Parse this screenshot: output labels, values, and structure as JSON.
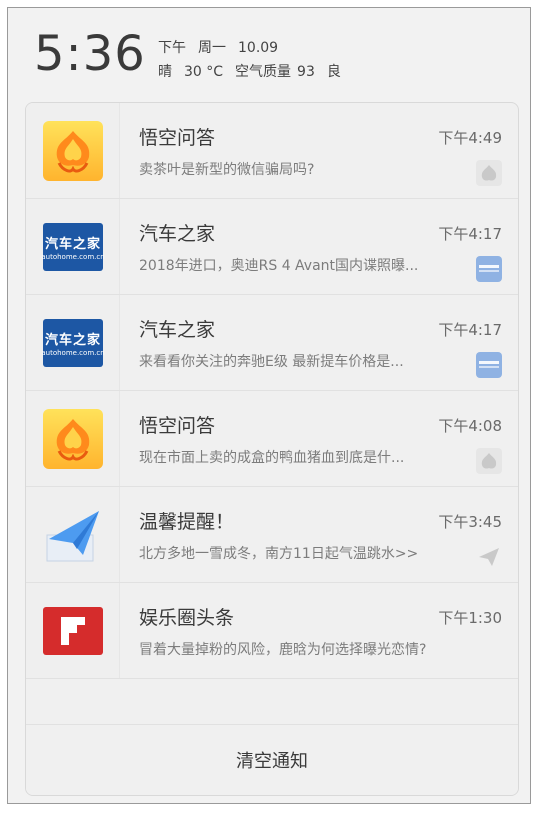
{
  "status": {
    "clock": "5:36",
    "period": "下午",
    "weekday": "周一",
    "date": "10.09",
    "weather": "晴",
    "temperature": "30 °C",
    "air_quality_label": "空气质量",
    "air_quality_value": "93",
    "air_quality_level": "良"
  },
  "notifications": [
    {
      "app": "悟空问答",
      "time": "下午4:49",
      "text": "卖茶叶是新型的微信骗局吗?",
      "icon": "wukong-icon"
    },
    {
      "app": "汽车之家",
      "time": "下午4:17",
      "text": "2018年进口，奥迪RS 4 Avant国内谍照曝...",
      "icon": "autohome-icon"
    },
    {
      "app": "汽车之家",
      "time": "下午4:17",
      "text": "来看看你关注的奔驰E级 最新提车价格是...",
      "icon": "autohome-icon"
    },
    {
      "app": "悟空问答",
      "time": "下午4:08",
      "text": "现在市面上卖的成盒的鸭血猪血到底是什...",
      "icon": "wukong-icon"
    },
    {
      "app": "温馨提醒！",
      "time": "下午3:45",
      "text": "北方多地一雪成冬，南方11日起气温跳水>>",
      "icon": "paper-plane-icon"
    },
    {
      "app": "娱乐圈头条",
      "time": "下午1:30",
      "text": "冒着大量掉粉的风险，鹿晗为何选择曝光恋情?",
      "icon": "flipboard-icon"
    }
  ],
  "autohome_logo": {
    "name": "汽车之家",
    "domain": "autohome.com.cn"
  },
  "footer": {
    "clear_label": "清空通知"
  },
  "colors": {
    "autohome_blue": "#1d57a4",
    "wukong_yellow": "#ffc83a",
    "flip_red": "#d52c2c",
    "plane_blue": "#3f8de6"
  }
}
